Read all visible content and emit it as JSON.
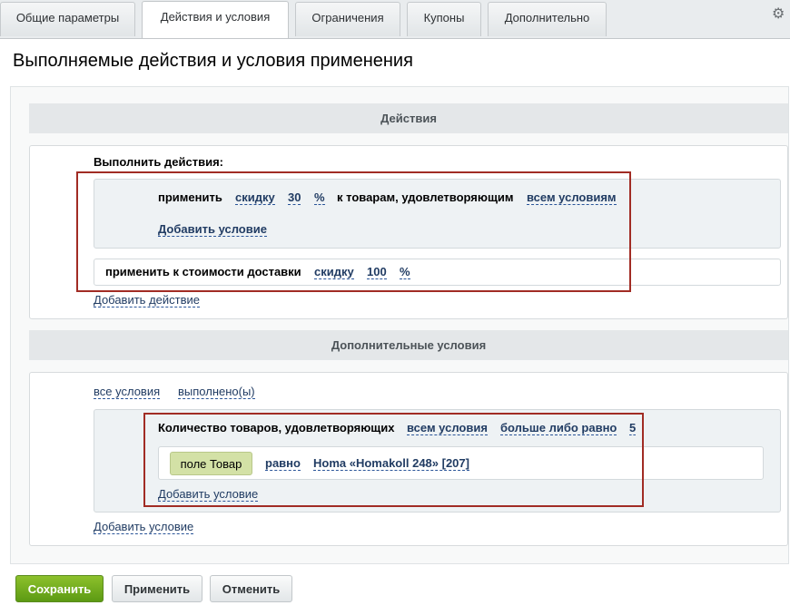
{
  "tabs": [
    "Общие параметры",
    "Действия и условия",
    "Ограничения",
    "Купоны",
    "Дополнительно"
  ],
  "page_title": "Выполняемые действия и условия применения",
  "actions": {
    "header": "Действия",
    "run_label": "Выполнить действия:",
    "discount": {
      "apply": "применить",
      "type": "скидку",
      "value": "30",
      "unit": "%",
      "to_goods": "к товарам, удовлетворяющим",
      "conditions": "всем условиям",
      "add_condition": "Добавить условие"
    },
    "delivery": {
      "apply_label": "применить к стоимости доставки",
      "type": "скидку",
      "value": "100",
      "unit": "%"
    },
    "add_action": "Добавить действие"
  },
  "extra": {
    "header": "Дополнительные условия",
    "all_conditions": "все условия",
    "fulfilled": "выполнено(ы)",
    "quantity_label": "Количество товаров, удовлетворяющих",
    "quantity_conditions": "всем условия",
    "comparison": "больше либо равно",
    "quantity_value": "5",
    "field_chip": "поле Товар",
    "equals": "равно",
    "product": "Homa «Homakoll 248» [207]",
    "add_condition_inner": "Добавить условие",
    "add_condition_outer": "Добавить условие"
  },
  "buttons": {
    "save": "Сохранить",
    "apply": "Применить",
    "cancel": "Отменить"
  }
}
